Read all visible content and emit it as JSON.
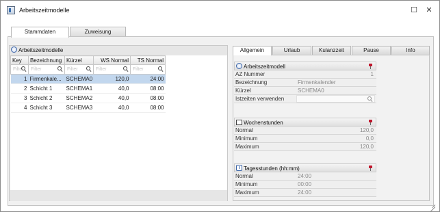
{
  "window": {
    "title": "Arbeitszeitmodelle",
    "icons": {
      "app": "window-app-icon",
      "maximize": "maximize-icon",
      "close": "close-icon"
    }
  },
  "top_tabs": [
    {
      "label": "Stammdaten",
      "active": true
    },
    {
      "label": "Zuweisung",
      "active": false
    }
  ],
  "left_panel": {
    "title": "Arbeitszeitmodelle",
    "columns": [
      "Key",
      "Bezeichnung",
      "Kürzel",
      "WS Normal",
      "TS Normal"
    ],
    "filter_placeholders": [
      "Filter",
      "Filter",
      "Filter",
      "Filter",
      "Filter"
    ],
    "rows": [
      {
        "key": "1",
        "bezeichnung": "Firmenkale...",
        "kuerzel": "SCHEMA0",
        "ws": "120,0",
        "ts": "24:00",
        "selected": true
      },
      {
        "key": "2",
        "bezeichnung": "Schicht 1",
        "kuerzel": "SCHEMA1",
        "ws": "40,0",
        "ts": "08:00",
        "selected": false
      },
      {
        "key": "3",
        "bezeichnung": "Schicht 2",
        "kuerzel": "SCHEMA2",
        "ws": "40,0",
        "ts": "08:00",
        "selected": false
      },
      {
        "key": "4",
        "bezeichnung": "Schicht 3",
        "kuerzel": "SCHEMA3",
        "ws": "40,0",
        "ts": "08:00",
        "selected": false
      }
    ]
  },
  "right_tabs": [
    {
      "label": "Allgemein",
      "active": true
    },
    {
      "label": "Urlaub",
      "active": false
    },
    {
      "label": "Kulanzzeit",
      "active": false
    },
    {
      "label": "Pause",
      "active": false
    },
    {
      "label": "Info",
      "active": false
    }
  ],
  "sections": {
    "azm": {
      "title": "Arbeitszeitmodell",
      "rows": [
        {
          "label": "AZ Nummer",
          "value": "1"
        },
        {
          "label": "Bezeichnung",
          "value": "Firmenkalender"
        },
        {
          "label": "Kürzel",
          "value": "SCHEMA0"
        },
        {
          "label": "Istzeiten verwenden",
          "value": ""
        }
      ]
    },
    "woche": {
      "title": "Wochenstunden",
      "rows": [
        {
          "label": "Normal",
          "value": "120,0"
        },
        {
          "label": "Minimum",
          "value": "0,0"
        },
        {
          "label": "Maximum",
          "value": "120,0"
        }
      ]
    },
    "tag": {
      "title": "Tagesstunden (hh:mm)",
      "rows": [
        {
          "label": "Normal",
          "value": "24:00"
        },
        {
          "label": "Minimum",
          "value": "00:00"
        },
        {
          "label": "Maximum",
          "value": "24:00"
        }
      ]
    }
  },
  "colors": {
    "selected_row": "#c2d7ee",
    "pin": "#c0152b",
    "accent": "#3a64a8"
  }
}
